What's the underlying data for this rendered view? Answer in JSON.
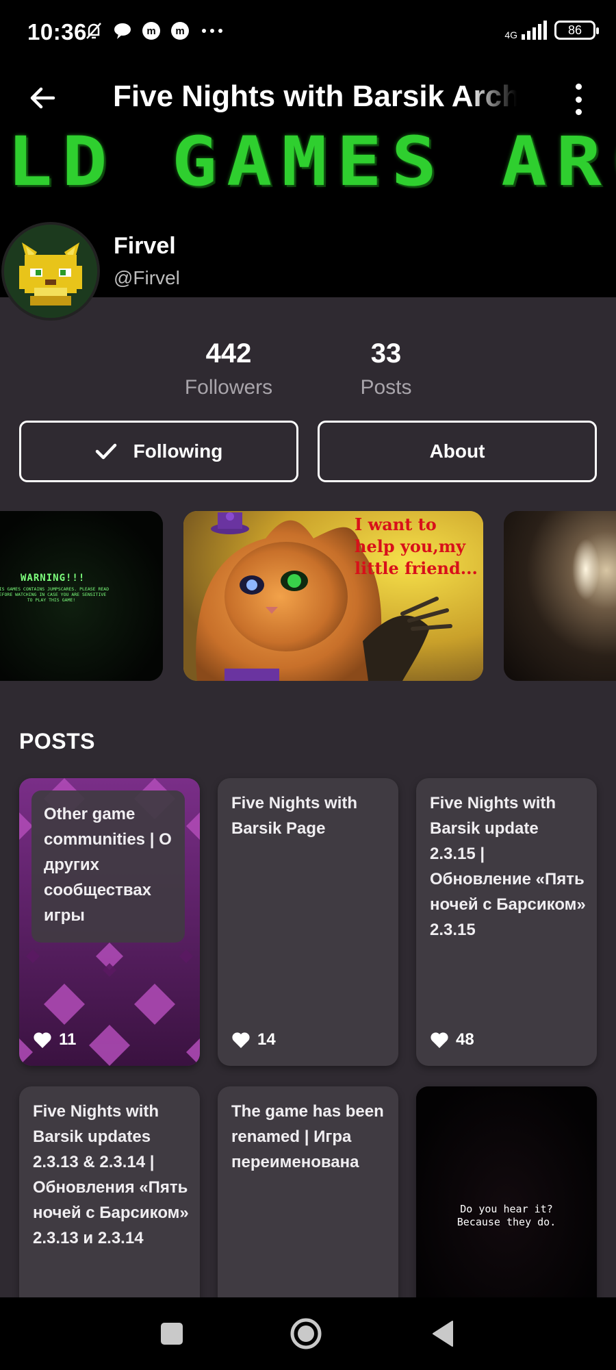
{
  "status_bar": {
    "time": "10:36",
    "network": "4G",
    "battery": "86"
  },
  "header": {
    "title": "Five Nights with Barsik Archive"
  },
  "banner": {
    "text": "OLD GAMES ARCHIVE"
  },
  "profile": {
    "name": "Firvel",
    "handle": "@Firvel"
  },
  "stats": [
    {
      "value": "442",
      "label": "Followers"
    },
    {
      "value": "33",
      "label": "Posts"
    }
  ],
  "buttons": {
    "following": "Following",
    "about": "About"
  },
  "featured": {
    "warning_title": "WARNING!!!",
    "warning_body": "THIS GAMES CONTAINS JUMPSCARES. PLEASE READ BEFORE WATCHING IN CASE YOU ARE SENSITIVE TO PLAY THIS GAME!",
    "cat_caption": "I want to help you,my little friend..."
  },
  "posts_section": {
    "title": "POSTS",
    "items": [
      {
        "title": "Other game communities | О других сообществах игры",
        "likes": "11"
      },
      {
        "title": "Five Nights with Barsik Page",
        "likes": "14"
      },
      {
        "title": "Five Nights with Barsik update 2.3.15 | Обновление «Пять ночей с Барсиком» 2.3.15",
        "likes": "48"
      },
      {
        "title": "Five Nights with Barsik updates 2.3.13 & 2.3.14 | Обновления «Пять ночей с Барсиком» 2.3.13 и 2.3.14"
      },
      {
        "title": "The game has been renamed | Игра переименована"
      },
      {
        "title": "Do you hear it? Because they do."
      }
    ]
  }
}
